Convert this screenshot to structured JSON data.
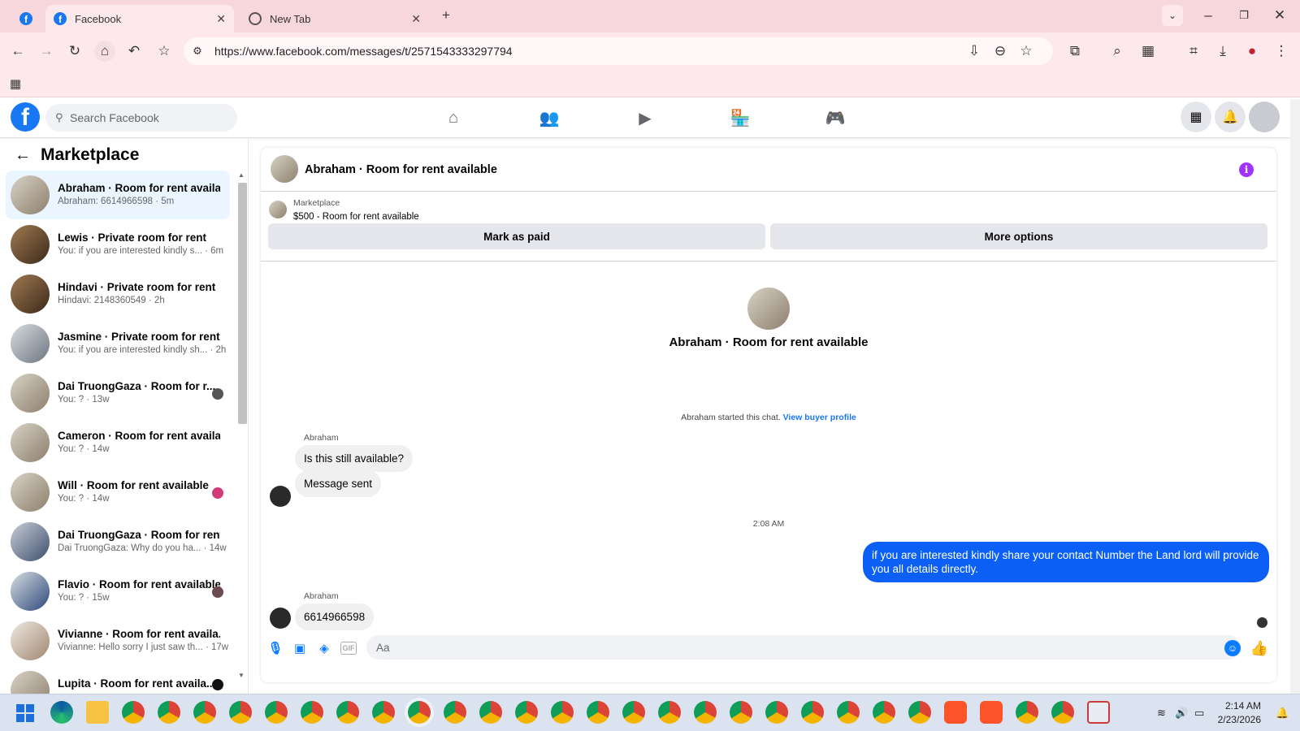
{
  "browser": {
    "tabs": [
      {
        "title": "Facebook",
        "active": true
      },
      {
        "title": "New Tab",
        "active": false
      }
    ],
    "url": "https://www.facebook.com/messages/t/2571543333297794"
  },
  "header": {
    "logo": "f",
    "search_placeholder": "Search Facebook"
  },
  "sidebar": {
    "title": "Marketplace",
    "conversations": [
      {
        "name": "Abraham · Room for rent availa...",
        "preview": "Abraham: 6614966598 · 5m",
        "active": true
      },
      {
        "name": "Lewis · Private room for rent",
        "preview": "You: if you are interested kindly s...  · 6m"
      },
      {
        "name": "Hindavi · Private room for rent",
        "preview": "Hindavi: 2148360549 · 2h"
      },
      {
        "name": "Jasmine · Private room for rent",
        "preview": "You: if you are interested kindly sh... · 2h"
      },
      {
        "name": "Dai TruongGaza · Room for r...",
        "preview": "You: ? · 13w"
      },
      {
        "name": "Cameron · Room for rent availa...",
        "preview": "You: ? · 14w"
      },
      {
        "name": "Will · Room for rent available",
        "preview": "You: ? · 14w"
      },
      {
        "name": "Dai TruongGaza · Room for rent...",
        "preview": "Dai TruongGaza: Why do you ha... · 14w"
      },
      {
        "name": "Flavio · Room for rent available",
        "preview": "You: ? · 15w"
      },
      {
        "name": "Vivianne · Room for rent availa...",
        "preview": "Vivianne: Hello sorry I just saw th... · 17w"
      },
      {
        "name": "Lupita · Room for rent availa...",
        "preview": ""
      }
    ]
  },
  "chat": {
    "title": "Abraham · Room for rent available",
    "listing_category": "Marketplace",
    "listing_price": "$500 - Room for rent available",
    "mark_paid_label": "Mark as paid",
    "more_options_label": "More options",
    "intro_name": "Abraham · Room for rent available",
    "started_text": "Abraham started this chat.",
    "view_profile_label": "View buyer profile",
    "sender_1": "Abraham",
    "msg_1": "Is this still available?",
    "msg_2": "Message sent",
    "timestamp": "2:08 AM",
    "msg_3": "if you are interested kindly share your contact Number the Land lord will provide you all details directly.",
    "sender_2": "Abraham",
    "msg_4": "6614966598",
    "input_placeholder": "Aa",
    "gif_label": "GIF"
  },
  "taskbar": {
    "time": "2:14 AM",
    "date": "2/23/2026"
  },
  "colors": {
    "fb_blue": "#1877f2",
    "my_bubble": "#0b5ff5",
    "browser_pink": "#f8d7dc"
  }
}
